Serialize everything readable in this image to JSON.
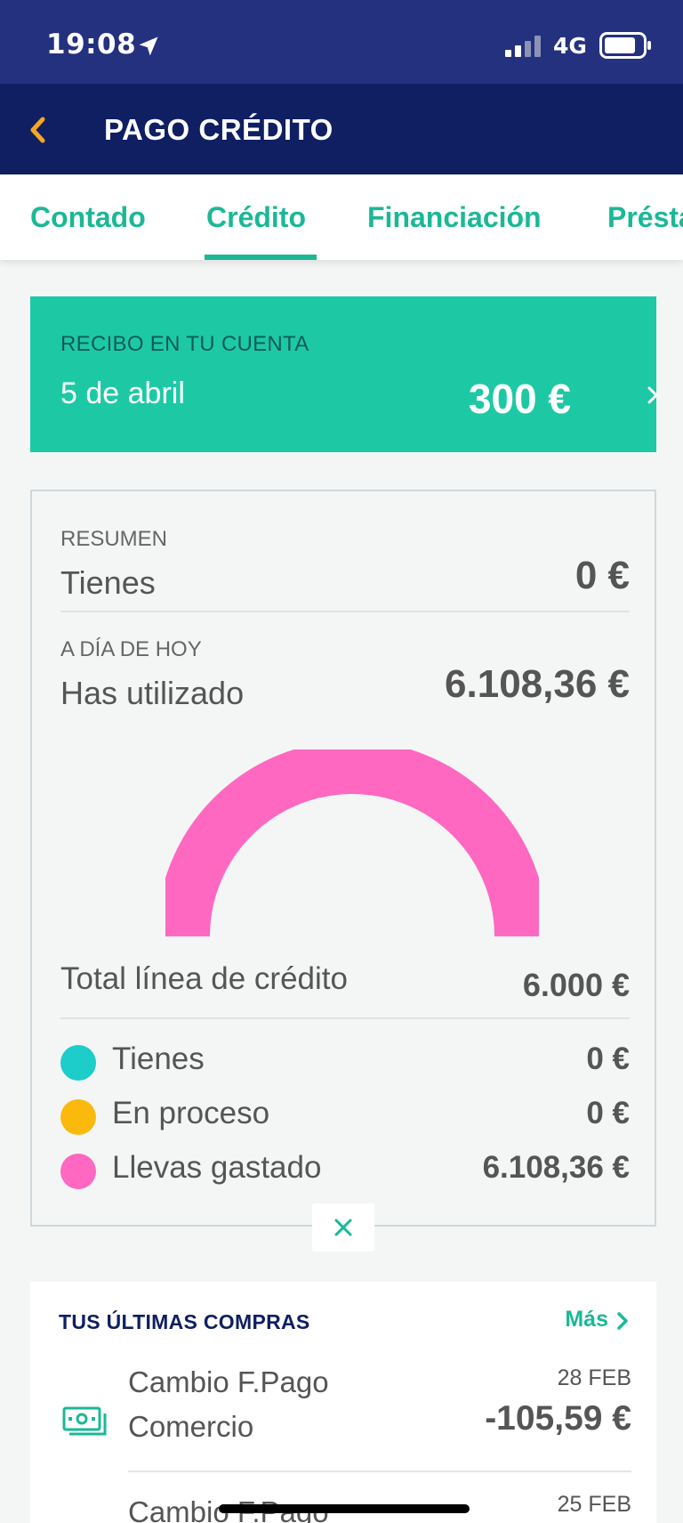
{
  "status_bar": {
    "time": "19:08",
    "network": "4G"
  },
  "header": {
    "title": "PAGO CRÉDITO"
  },
  "tabs": [
    {
      "label": "Contado"
    },
    {
      "label": "Crédito"
    },
    {
      "label": "Financiación"
    },
    {
      "label": "Préstamos"
    }
  ],
  "active_tab": "Crédito",
  "receipt": {
    "label": "RECIBO EN TU CUENTA",
    "date": "5 de abril",
    "amount": "300 €"
  },
  "summary": {
    "resumen_label": "RESUMEN",
    "tienes_label": "Tienes",
    "tienes_value": "0 €",
    "today_label": "A DÍA DE HOY",
    "used_label": "Has utilizado",
    "used_value": "6.108,36 €",
    "gauge_used_fraction": 1.0,
    "total_label": "Total línea de crédito",
    "total_value": "6.000 €",
    "legend": [
      {
        "label": "Tienes",
        "value": "0 €",
        "color": "#1ccdc9"
      },
      {
        "label": "En proceso",
        "value": "0 €",
        "color": "#fbb90d"
      },
      {
        "label": "Llevas gastado",
        "value": "6.108,36 €",
        "color": "#ff68c1"
      }
    ]
  },
  "purchases": {
    "title": "TUS ÚLTIMAS COMPRAS",
    "more_label": "Más",
    "items": [
      {
        "name_line1": "Cambio F.Pago",
        "name_line2": "Comercio",
        "date": "28 FEB",
        "amount": "-105,59 €"
      },
      {
        "name_line1": "Cambio F.Pago",
        "date": "25 FEB"
      }
    ]
  },
  "colors": {
    "status_bar": "#24317f",
    "header": "#0f1f62",
    "accent": "#1bb896",
    "receipt_bg": "#1dc9a5",
    "gauge_used": "#ff68c1"
  }
}
